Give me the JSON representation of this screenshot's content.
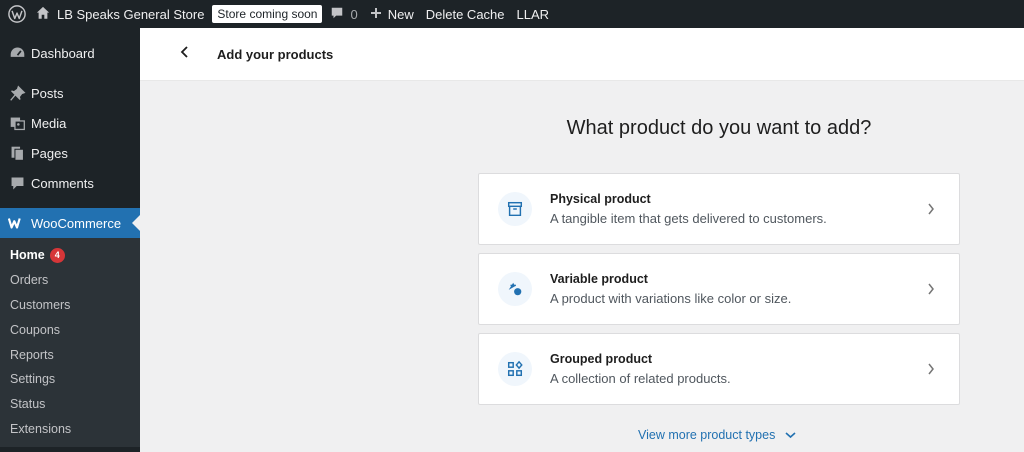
{
  "adminbar": {
    "site_name": "LB Speaks General Store",
    "badge": "Store coming soon",
    "comments_count": "0",
    "new_label": "New",
    "delete_cache": "Delete Cache",
    "llar": "LLAR"
  },
  "sidebar": {
    "items": [
      {
        "label": "Dashboard",
        "icon": "dashboard-icon"
      },
      {
        "label": "Posts",
        "icon": "pin-icon"
      },
      {
        "label": "Media",
        "icon": "media-icon"
      },
      {
        "label": "Pages",
        "icon": "pages-icon"
      },
      {
        "label": "Comments",
        "icon": "comment-icon"
      },
      {
        "label": "WooCommerce",
        "icon": "woocommerce-icon"
      }
    ],
    "submenu": [
      {
        "label": "Home",
        "badge": "4"
      },
      {
        "label": "Orders"
      },
      {
        "label": "Customers"
      },
      {
        "label": "Coupons"
      },
      {
        "label": "Reports"
      },
      {
        "label": "Settings"
      },
      {
        "label": "Status"
      },
      {
        "label": "Extensions"
      }
    ]
  },
  "header": {
    "title": "Add your products"
  },
  "main": {
    "title": "What product do you want to add?",
    "cards": [
      {
        "title": "Physical product",
        "desc": "A tangible item that gets delivered to customers.",
        "icon": "archive-box-icon"
      },
      {
        "title": "Variable product",
        "desc": "A product with variations like color or size.",
        "icon": "shapes-icon"
      },
      {
        "title": "Grouped product",
        "desc": "A collection of related products.",
        "icon": "grid-group-icon"
      }
    ],
    "more_link": "View more product types"
  },
  "colors": {
    "adminbar_bg": "#1d2327",
    "accent": "#2271b1",
    "badge_red": "#d63638"
  }
}
